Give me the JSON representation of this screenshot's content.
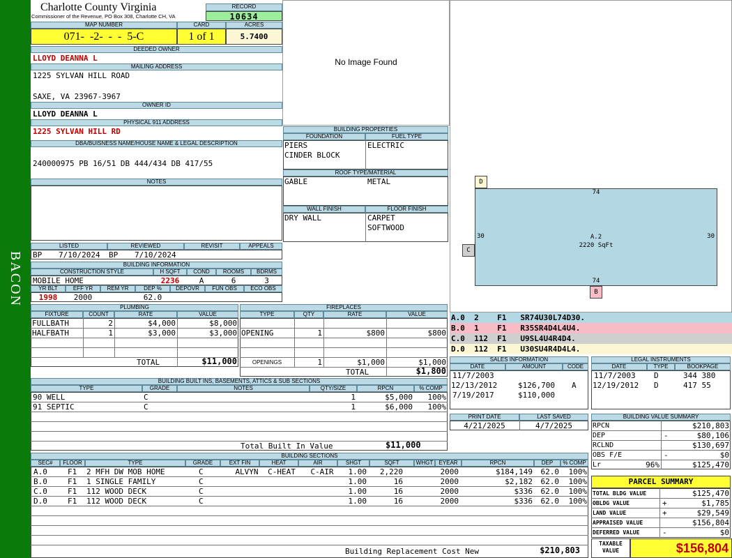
{
  "sidebar": {
    "label": "BACON"
  },
  "header": {
    "county": "Charlotte County Virginia",
    "office": "Commissioner of the Revenue, PO Box 308, Charlotte CH, VA",
    "record_label": "RECORD",
    "record": "10634"
  },
  "labels": {
    "map_number": "MAP NUMBER",
    "card": "CARD",
    "acres": "ACRES",
    "deeded_owner": "DEEDED OWNER",
    "mailing_address": "MAILING ADDRESS",
    "owner_id": "OWNER ID",
    "physical_address": "PHYSICAL 911 ADDRESS",
    "dba": "DBA/BUISNESS NAME/HOUSE NAME & LEGAL DESCRIPTION",
    "notes": "NOTES",
    "listed": "LISTED",
    "reviewed": "REVIEWED",
    "revisit": "REVISIT",
    "appeals": "APPEALS",
    "building_information": "BUILDING INFORMATION",
    "construction_style": "CONSTRUCTION STYLE",
    "hsqft": "H SQFT",
    "cond": "COND",
    "rooms": "ROOMS",
    "bdrms": "BDRMS",
    "yr_blt": "YR BLT",
    "eff_yr": "EFF YR",
    "rem_yr": "REM YR",
    "dep_pct": "DEP %",
    "depovr": "DEPOVR",
    "fun_obs": "FUN OBS",
    "eco_obs": "ECO OBS",
    "building_properties": "BUILDING PROPERTIES",
    "foundation": "FOUNDATION",
    "fuel_type": "FUEL TYPE",
    "roof": "ROOF TYPE/MATERIAL",
    "wall_finish": "WALL FINISH",
    "floor_finish": "FLOOR FINISH"
  },
  "map_number": "071-  -2-  -  -  5-C",
  "card": "1 of 1",
  "acres": "5.7400",
  "owner": {
    "deeded": "LLOYD DEANNA L",
    "address1": "1225 SYLVAN HILL ROAD",
    "address2": "SAXE, VA 23967-3967",
    "owner_id": "LLOYD DEANNA L",
    "physical": "1225 SYLVAN HILL RD",
    "legal": "240000975 PB 16/51 DB 444/434 DB 417/55"
  },
  "dates": {
    "listed_by": "BP",
    "listed": "7/10/2024",
    "reviewed_by": "BP",
    "reviewed": "7/10/2024"
  },
  "building": {
    "style": "MOBILE HOME",
    "hsqft": "2236",
    "cond": "A",
    "rooms": "6",
    "bdrms": "3",
    "yr_blt": "1998",
    "eff_yr": "2000",
    "dep_pct": "62.0"
  },
  "image_placeholder": "No Image Found",
  "properties": {
    "foundation1": "PIERS",
    "foundation2": "CINDER BLOCK",
    "fuel": "ELECTRIC",
    "roof1": "GABLE",
    "roof2": "METAL",
    "wall": "DRY WALL",
    "floor1": "CARPET",
    "floor2": "SOFTWOOD"
  },
  "plumbing": {
    "title": "PLUMBING",
    "headers": [
      "FIXTURE",
      "COUNT",
      "RATE",
      "VALUE"
    ],
    "rows": [
      [
        "FULLBATH",
        "2",
        "$4,000",
        "$8,000"
      ],
      [
        "HALFBATH",
        "1",
        "$3,000",
        "$3,000"
      ]
    ],
    "total_label": "TOTAL",
    "total": "$11,000"
  },
  "fireplaces": {
    "title": "FIREPLACES",
    "headers": [
      "TYPE",
      "QTY",
      "RATE",
      "VALUE"
    ],
    "rows": [
      [
        "OPENING",
        "1",
        "$800",
        "$800"
      ]
    ],
    "openings_label": "OPENINGS",
    "openings": [
      "1",
      "$1,000",
      "$1,000"
    ],
    "total_label": "TOTAL",
    "total": "$1,800"
  },
  "builtins": {
    "title": "BUILDING BUILT INS, BASEMENTS, ATTICS & SUB SECTIONS",
    "headers": [
      "TYPE",
      "GRADE",
      "NOTES",
      "QTY/SIZE",
      "RPCN",
      "% COMP"
    ],
    "rows": [
      [
        "90 WELL",
        "C",
        "",
        "1",
        "$5,000",
        "100%"
      ],
      [
        "91 SEPTIC",
        "C",
        "",
        "1",
        "$6,000",
        "100%"
      ]
    ],
    "total_label": "Total Built In Value",
    "total": "$11,000"
  },
  "sections": {
    "title": "BUILDING SECTIONS",
    "headers": [
      "SEC#",
      "FLOOR",
      "TYPE",
      "GRADE",
      "EXT FIN",
      "HEAT",
      "AIR",
      "SHGT",
      "SQFT",
      "WHGT",
      "EYEAR",
      "RPCN",
      "DEP",
      "% COMP"
    ],
    "rows": [
      [
        "A.0",
        "F1",
        "2 MFH DW MOB HOME",
        "C",
        "ALVYN",
        "C-HEAT",
        "C-AIR",
        "1.00",
        "2,220",
        "",
        "2000",
        "$184,149",
        "62.0",
        "100%"
      ],
      [
        "B.0",
        "F1",
        "1 SINGLE FAMILY",
        "C",
        "",
        "",
        "",
        "1.00",
        "16",
        "",
        "2000",
        "$2,182",
        "62.0",
        "100%"
      ],
      [
        "C.0",
        "F1",
        "112 WOOD DECK",
        "C",
        "",
        "",
        "",
        "1.00",
        "16",
        "",
        "2000",
        "$336",
        "62.0",
        "100%"
      ],
      [
        "D.0",
        "F1",
        "112 WOOD DECK",
        "C",
        "",
        "",
        "",
        "1.00",
        "16",
        "",
        "2000",
        "$336",
        "62.0",
        "100%"
      ]
    ],
    "total_label": "Building Replacement Cost New",
    "total": "$210,803"
  },
  "sketch": {
    "main_label": "A.2",
    "main_area": "2220 SqFt",
    "dim_top": "74",
    "dim_bottom": "74",
    "dim_left": "30",
    "dim_right": "30",
    "tag_b": "B",
    "tag_c": "C",
    "tag_d": "D"
  },
  "sketch_legend": [
    {
      "code": "A.0  2    F1   SR74U30L74D30.",
      "color": "#b4d7e4"
    },
    {
      "code": "B.0  1    F1   R35SR4D4L4U4.",
      "color": "#f8bcc6"
    },
    {
      "code": "C.0  112  F1   U9SL4U4R4D4.",
      "color": "#cfcfcf"
    },
    {
      "code": "D.0  112  F1   U30SU4R4D4L4.",
      "color": "#fbf7d4"
    }
  ],
  "sales": {
    "title": "SALES INFORMATION",
    "headers": [
      "DATE",
      "AMOUNT",
      "CODE"
    ],
    "rows": [
      [
        "11/7/2003",
        "",
        ""
      ],
      [
        "12/13/2012",
        "$126,700",
        "A"
      ],
      [
        "7/19/2017",
        "$110,000",
        ""
      ]
    ]
  },
  "legal": {
    "title": "LEGAL INSTRUMENTS",
    "headers": [
      "DATE",
      "TYPE",
      "BOOKPAGE"
    ],
    "rows": [
      [
        "11/7/2003",
        "D",
        "344 380"
      ],
      [
        "12/19/2012",
        "D",
        "417 55"
      ]
    ]
  },
  "print": {
    "print_label": "PRINT DATE",
    "print_date": "4/21/2025",
    "saved_label": "LAST SAVED",
    "saved_date": "4/7/2025"
  },
  "value_summary": {
    "title": "BUILDING VALUE SUMMARY",
    "rows": [
      [
        "RPCN",
        "",
        "$210,803"
      ],
      [
        "DEP",
        "-",
        "$80,106"
      ],
      [
        "RCLND",
        "",
        "$130,697"
      ],
      [
        "OBS F/E",
        "-",
        "$0"
      ],
      [
        "Lr",
        "96%",
        "$125,470"
      ]
    ]
  },
  "parcel": {
    "title": "PARCEL SUMMARY",
    "rows": [
      [
        "TOTAL BLDG VALUE",
        "",
        "$125,470"
      ],
      [
        "OBLDG VALUE",
        "+",
        "$1,785"
      ],
      [
        "LAND VALUE",
        "+",
        "$29,549"
      ],
      [
        "APPRAISED VALUE",
        "",
        "$156,804"
      ],
      [
        "DEFERRED VALUE",
        "-",
        "$0"
      ]
    ],
    "taxable_label1": "TAXABLE",
    "taxable_label2": "VALUE",
    "taxable": "$156,804"
  }
}
